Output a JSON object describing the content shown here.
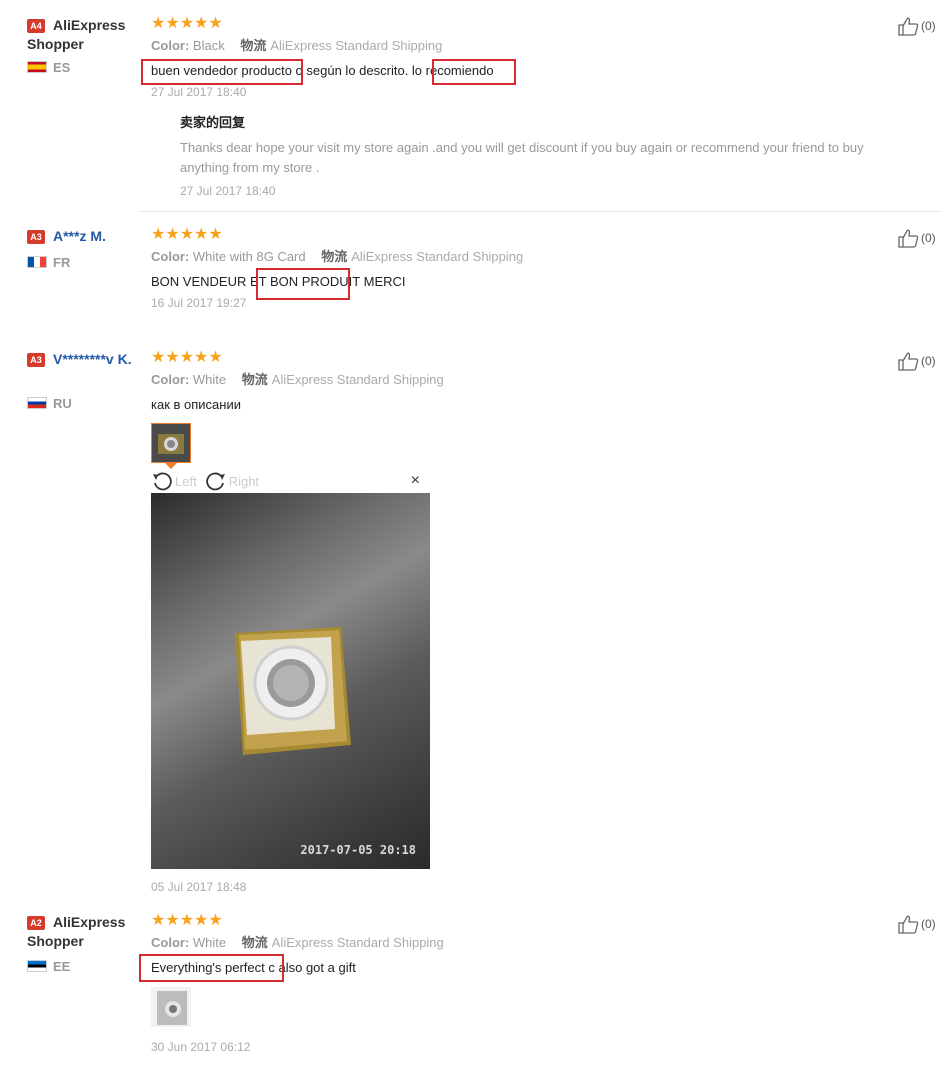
{
  "reviews": [
    {
      "badge": "A4",
      "badge_color": "#d63a2a",
      "user": "AliExpress Shopper",
      "user_link": false,
      "country": "ES",
      "stars": "★★★★★",
      "color_label": "Color:",
      "color_value": "Black",
      "logistics_label": "物流",
      "shipping": "AliExpress Standard Shipping",
      "text": "buen vendedor producto o según lo descrito. lo recomiendo",
      "date": "27 Jul 2017 18:40",
      "reply": {
        "title": "卖家的回复",
        "text": "Thanks dear hope your visit my store again .and you will get discount if you buy again or recommend your friend to buy anything from my store .",
        "date": "27 Jul 2017 18:40"
      },
      "likes": "(0)"
    },
    {
      "badge": "A3",
      "badge_color": "#d63a2a",
      "user": "A***z M.",
      "user_link": true,
      "country": "FR",
      "stars": "★★★★★",
      "color_label": "Color:",
      "color_value": "White with 8G Card",
      "logistics_label": "物流",
      "shipping": "AliExpress Standard Shipping",
      "text": "BON VENDEUR ET BON PRODUIT MERCI",
      "date": "16 Jul 2017 19:27",
      "likes": "(0)"
    },
    {
      "badge": "A3",
      "badge_color": "#d63a2a",
      "user": "V********v K.",
      "user_link": true,
      "country": "RU",
      "stars": "★★★★★",
      "color_label": "Color:",
      "color_value": "White",
      "logistics_label": "物流",
      "shipping": "AliExpress Standard Shipping",
      "text": "как в описании",
      "viewer": {
        "left_label": "Left",
        "right_label": "Right",
        "close": "×",
        "timestamp": "2017-07-05 20:18"
      },
      "date": "05 Jul 2017 18:48",
      "likes": "(0)"
    },
    {
      "badge": "A2",
      "badge_color": "#d63a2a",
      "user": "AliExpress Shopper",
      "user_link": false,
      "country": "EE",
      "stars": "★★★★★",
      "color_label": "Color:",
      "color_value": "White",
      "logistics_label": "物流",
      "shipping": "AliExpress Standard Shipping",
      "text": "Everything's perfect c also got a gift",
      "date": "30 Jun 2017 06:12",
      "likes": "(0)"
    }
  ]
}
